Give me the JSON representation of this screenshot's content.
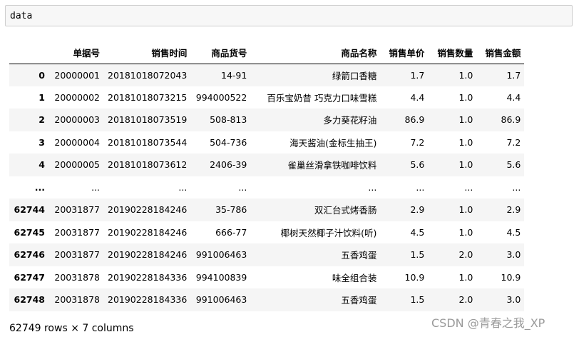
{
  "cell": {
    "code": "data"
  },
  "table": {
    "columns": [
      "",
      "单据号",
      "销售时间",
      "商品货号",
      "商品名称",
      "销售单价",
      "销售数量",
      "销售金额"
    ],
    "rows": [
      [
        "0",
        "20000001",
        "20181018072043",
        "14-91",
        "绿箭口香糖",
        "1.7",
        "1.0",
        "1.7"
      ],
      [
        "1",
        "20000002",
        "20181018073215",
        "994000522",
        "百乐宝奶昔 巧克力口味雪糕",
        "4.4",
        "1.0",
        "4.4"
      ],
      [
        "2",
        "20000003",
        "20181018073519",
        "508-813",
        "多力葵花籽油",
        "86.9",
        "1.0",
        "86.9"
      ],
      [
        "3",
        "20000004",
        "20181018073544",
        "504-736",
        "海天酱油(金标生抽王)",
        "7.2",
        "1.0",
        "7.2"
      ],
      [
        "4",
        "20000005",
        "20181018073612",
        "2406-39",
        "雀巢丝滑拿铁咖啡饮料",
        "5.6",
        "1.0",
        "5.6"
      ],
      [
        "...",
        "...",
        "...",
        "...",
        "...",
        "...",
        "...",
        "..."
      ],
      [
        "62744",
        "20031877",
        "20190228184246",
        "35-786",
        "双汇台式烤香肠",
        "2.9",
        "1.0",
        "2.9"
      ],
      [
        "62745",
        "20031877",
        "20190228184246",
        "666-77",
        "椰树天然椰子汁饮料(听)",
        "4.5",
        "1.0",
        "4.5"
      ],
      [
        "62746",
        "20031877",
        "20190228184246",
        "991006463",
        "五香鸡蛋",
        "1.5",
        "2.0",
        "3.0"
      ],
      [
        "62747",
        "20031878",
        "20190228184336",
        "994100839",
        "味全组合装",
        "10.9",
        "1.0",
        "10.9"
      ],
      [
        "62748",
        "20031878",
        "20190228184336",
        "991006463",
        "五香鸡蛋",
        "1.5",
        "2.0",
        "3.0"
      ]
    ]
  },
  "shape_info": "62749 rows × 7 columns",
  "watermark": "CSDN @青春之我_XP"
}
